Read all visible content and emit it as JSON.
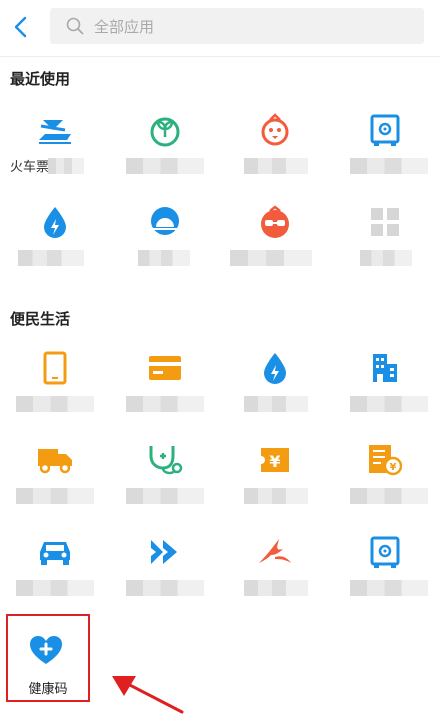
{
  "search": {
    "placeholder": "全部应用"
  },
  "sections": {
    "recent": {
      "title": "最近使用"
    },
    "life": {
      "title": "便民生活"
    }
  },
  "recent_apps": [
    {
      "label": "火车票",
      "icon": "train-ticket-icon",
      "color": "#1a8fe6"
    },
    {
      "label": "",
      "icon": "sprout-icon",
      "color": "#2bb17e"
    },
    {
      "label": "",
      "icon": "chick-icon",
      "color": "#f25b3b"
    },
    {
      "label": "",
      "icon": "safe-icon",
      "color": "#1a8fe6"
    },
    {
      "label": "",
      "icon": "water-drop-bolt-icon",
      "color": "#1a8fe6"
    },
    {
      "label": "",
      "icon": "sunrise-icon",
      "color": "#1a8fe6"
    },
    {
      "label": "",
      "icon": "glasses-bird-icon",
      "color": "#f25b3b"
    },
    {
      "label": "",
      "icon": "grid-icon",
      "color": "#d6d6d6"
    }
  ],
  "life_apps": [
    {
      "label": "",
      "icon": "phone-icon",
      "color": "#f39c12"
    },
    {
      "label": "",
      "icon": "card-icon",
      "color": "#f39c12"
    },
    {
      "label": "",
      "icon": "water-drop-bolt-icon",
      "color": "#1a8fe6"
    },
    {
      "label": "",
      "icon": "building-icon",
      "color": "#1a8fe6"
    },
    {
      "label": "",
      "icon": "truck-icon",
      "color": "#f39c12"
    },
    {
      "label": "",
      "icon": "stethoscope-icon",
      "color": "#2bb17e"
    },
    {
      "label": "",
      "icon": "yen-ticket-icon",
      "color": "#f39c12"
    },
    {
      "label": "",
      "icon": "invoice-icon",
      "color": "#f39c12"
    },
    {
      "label": "",
      "icon": "car-icon",
      "color": "#1a8fe6"
    },
    {
      "label": "",
      "icon": "double-chevron-icon",
      "color": "#1a8fe6"
    },
    {
      "label": "",
      "icon": "swallow-icon",
      "color": "#f25b3b"
    },
    {
      "label": "",
      "icon": "safe-icon",
      "color": "#1a8fe6"
    }
  ],
  "health_app": {
    "label": "健康码",
    "icon": "heart-plus-icon",
    "color": "#1a8fe6"
  },
  "colors": {
    "accent": "#1a8fe6",
    "highlight": "#e02020"
  }
}
